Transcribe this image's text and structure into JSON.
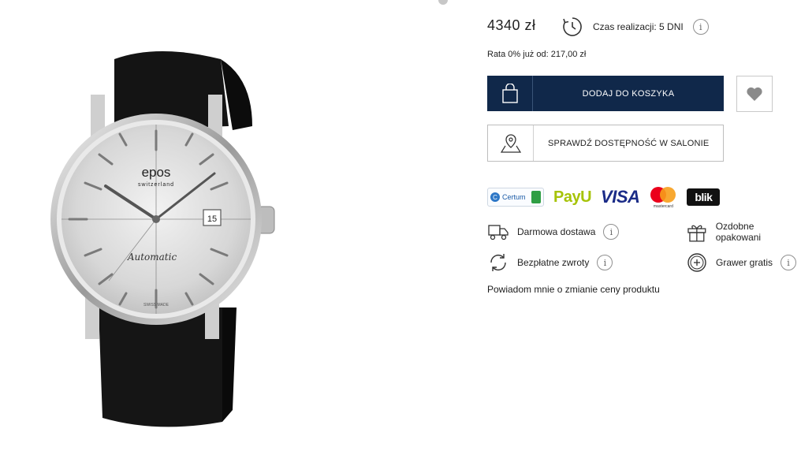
{
  "product": {
    "price": "4340 zł",
    "lead_time": "Czas realizacji: 5 DNI",
    "installment": "Rata 0% już od: 217,00 zł",
    "dial_brand": "epos",
    "dial_country": "switzerland",
    "dial_automatic": "Automatic",
    "dial_swiss_made": "SWISS   MADE",
    "date_window": "15"
  },
  "actions": {
    "add_to_cart": "DODAJ DO KOSZYKA",
    "check_store": "SPRAWDŹ DOSTĘPNOŚĆ W SALONIE"
  },
  "payments": {
    "certum": "Certum",
    "payu": "PayU",
    "visa": "VISA",
    "mastercard": "mastercard",
    "blik": "blik"
  },
  "benefits": {
    "free_delivery": "Darmowa dostawa",
    "gift_wrap": "Ozdobne opakowani",
    "free_returns": "Bezpłatne zwroty",
    "engraving": "Grawer gratis"
  },
  "info_icon": "i",
  "notify": "Powiadom mnie o zmianie ceny produktu",
  "colors": {
    "primary_navy": "#10284a",
    "payu_green": "#a6c307",
    "visa_blue": "#1a2b87"
  }
}
